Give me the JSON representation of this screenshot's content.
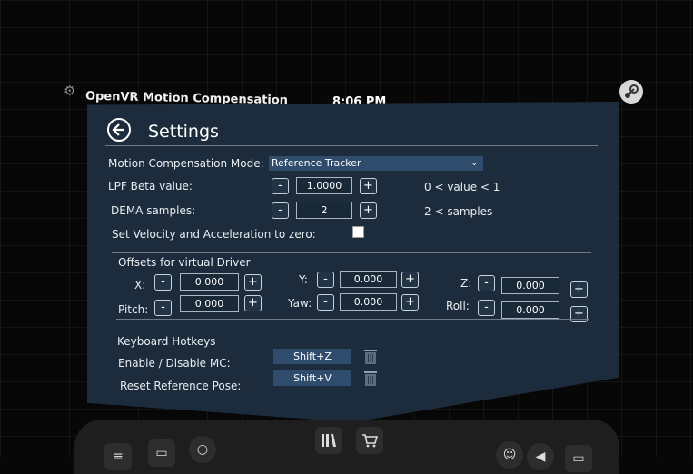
{
  "app": {
    "title": "OpenVR Motion Compensation",
    "time": "8:06 PM"
  },
  "page": {
    "title": "Settings"
  },
  "settings": {
    "mode_label": "Motion Compensation Mode:",
    "mode_value": "Reference Tracker",
    "lpf_label": "LPF Beta value:",
    "lpf_value": "1.0000",
    "lpf_hint": "0 < value < 1",
    "dema_label": "DEMA samples:",
    "dema_value": "2",
    "dema_hint": "2 < samples",
    "zero_label": "Set Velocity and Acceleration to zero:",
    "zero_checked": false
  },
  "offsets": {
    "title": "Offsets for virtual Driver",
    "x_label": "X:",
    "x_value": "0.000",
    "y_label": "Y:",
    "y_value": "0.000",
    "z_label": "Z:",
    "z_value": "0.000",
    "pitch_label": "Pitch:",
    "pitch_value": "0.000",
    "yaw_label": "Yaw:",
    "yaw_value": "0.000",
    "roll_label": "Roll:",
    "roll_value": "0.000"
  },
  "hotkeys": {
    "title": "Keyboard Hotkeys",
    "enable_label": "Enable / Disable MC:",
    "enable_value": "Shift+Z",
    "reset_label": "Reset Reference Pose:",
    "reset_value": "Shift+V"
  },
  "controls": {
    "minus": "-",
    "plus": "+"
  },
  "icons": {
    "gear": "gear-icon",
    "steam": "steam-logo-icon",
    "back": "back-arrow-icon",
    "trash": "trash-icon",
    "library": "library-icon",
    "cart": "cart-icon"
  },
  "colors": {
    "panel": "#1d2c3c",
    "select_bg": "#2f4c6c",
    "status_green": "#3bd14a"
  }
}
